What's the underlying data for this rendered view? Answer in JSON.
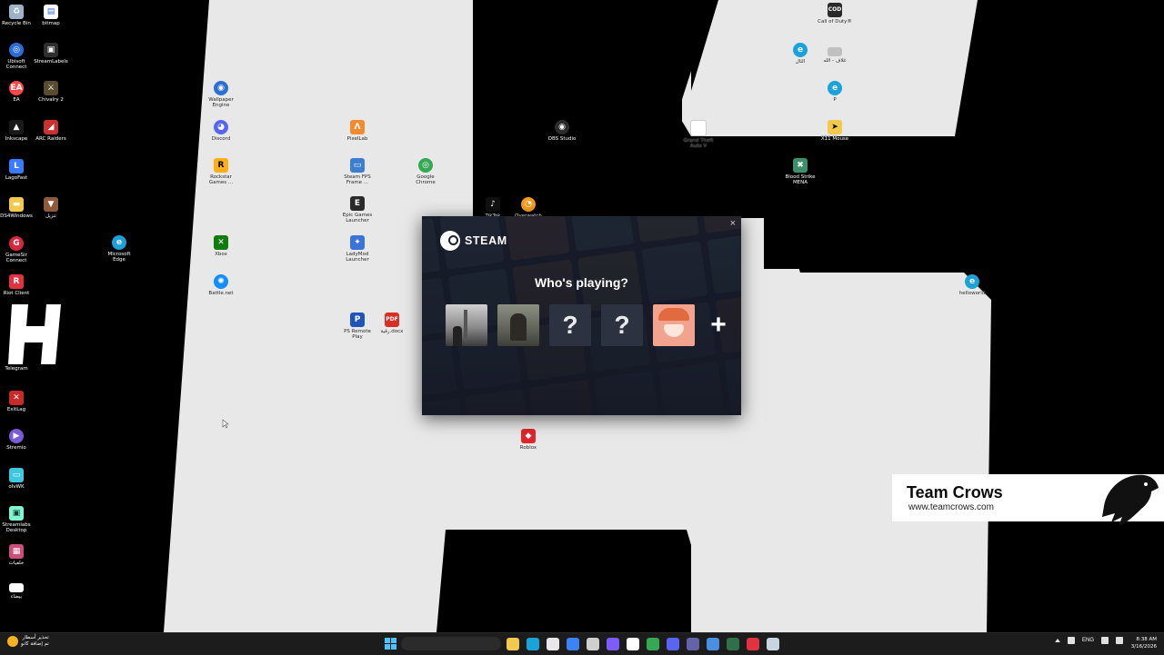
{
  "desktop_icons": [
    {
      "id": "recycle",
      "label": "Recycle Bin",
      "icon": "recycle-bin-icon",
      "color": "#9fb3c8"
    },
    {
      "id": "bitmap",
      "label": "bitmap",
      "icon": "file-icon",
      "color": "#ffffff"
    },
    {
      "id": "ubisoft",
      "label": "Ubisoft Connect",
      "icon": "ubisoft-icon",
      "color": "#2b6cd8"
    },
    {
      "id": "streamlabels",
      "label": "StreamLabels",
      "icon": "streamlabels-icon",
      "color": "#2e2e2e"
    },
    {
      "id": "ea",
      "label": "EA",
      "icon": "ea-icon",
      "color": "#ff4747"
    },
    {
      "id": "chivalry",
      "label": "Chivalry 2",
      "icon": "chivalry-icon",
      "color": "#5a4a2e"
    },
    {
      "id": "inkscape",
      "label": "Inkscape",
      "icon": "inkscape-icon",
      "color": "#1a1a1a"
    },
    {
      "id": "arc",
      "label": "ARC Raiders",
      "icon": "arc-raiders-icon",
      "color": "#c8322f"
    },
    {
      "id": "lagofast",
      "label": "LagoFast",
      "icon": "lagofast-icon",
      "color": "#3a7bff"
    },
    {
      "id": "ds4",
      "label": "DS4Windows",
      "icon": "folder-icon",
      "color": "#f2c94c"
    },
    {
      "id": "tanzil",
      "label": "تنزيل",
      "icon": "app-icon",
      "color": "#8d5a3b"
    },
    {
      "id": "gamesir",
      "label": "GameSir Connect",
      "icon": "gamesir-icon",
      "color": "#d7263d"
    },
    {
      "id": "msedge",
      "label": "Microsoft Edge",
      "icon": "edge-icon",
      "color": "#1aa3d8"
    },
    {
      "id": "riot",
      "label": "Riot Client",
      "icon": "riot-icon",
      "color": "#e0333f"
    },
    {
      "id": "telegram",
      "label": "Telegram",
      "icon": "telegram-icon",
      "color": "#2aa3e0"
    },
    {
      "id": "exitlag",
      "label": "ExitLag",
      "icon": "exitlag-icon",
      "color": "#c92a2a"
    },
    {
      "id": "stremio",
      "label": "Stremio",
      "icon": "stremio-icon",
      "color": "#7b5bd6"
    },
    {
      "id": "olvwk",
      "label": "olvWK",
      "icon": "app-icon",
      "color": "#3fc6e0"
    },
    {
      "id": "streamlabs",
      "label": "Streamlabs Desktop",
      "icon": "streamlabs-icon",
      "color": "#80f5d2"
    },
    {
      "id": "h1",
      "label": "خلفيات",
      "icon": "image-icon",
      "color": "#c94f7c"
    },
    {
      "id": "h2",
      "label": "بيضاء",
      "icon": "blank-icon",
      "color": "#ffffff"
    },
    {
      "id": "wallpaper",
      "label": "Wallpaper Engine",
      "icon": "wallpaper-engine-icon",
      "color": "#2a6fd4"
    },
    {
      "id": "discord",
      "label": "Discord",
      "icon": "discord-icon",
      "color": "#5865f2"
    },
    {
      "id": "rockstar",
      "label": "Rockstar Games ...",
      "icon": "rockstar-icon",
      "color": "#fcaf17"
    },
    {
      "id": "xbox",
      "label": "Xbox",
      "icon": "xbox-icon",
      "color": "#107c10"
    },
    {
      "id": "battlenet",
      "label": "Battle.net",
      "icon": "battlenet-icon",
      "color": "#148eff"
    },
    {
      "id": "pixelab",
      "label": "PixelLab",
      "icon": "pixellab-icon",
      "color": "#f28b30"
    },
    {
      "id": "steamfps",
      "label": "Steam FPS Frame ...",
      "icon": "app-icon",
      "color": "#3e7ecf"
    },
    {
      "id": "epic",
      "label": "Epic Games Launcher",
      "icon": "epic-icon",
      "color": "#2a2a2a"
    },
    {
      "id": "ladymod",
      "label": "LadyMod Launcher",
      "icon": "ladymod-icon",
      "color": "#3a74d8"
    },
    {
      "id": "ps",
      "label": "PS Remote Play",
      "icon": "ps-remote-icon",
      "color": "#1f55b8"
    },
    {
      "id": "pdf",
      "label": "رقية.docx",
      "icon": "pdf-icon",
      "color": "#d93025"
    },
    {
      "id": "chrome",
      "label": "Google Chrome",
      "icon": "chrome-icon",
      "color": "#34a853"
    },
    {
      "id": "tiktok",
      "label": "TikTok",
      "icon": "tiktok-icon",
      "color": "#111111"
    },
    {
      "id": "overwatch",
      "label": "Overwatch",
      "icon": "overwatch-icon",
      "color": "#f79d1f"
    },
    {
      "id": "obs",
      "label": "OBS Studio",
      "icon": "obs-icon",
      "color": "#2b2b2b"
    },
    {
      "id": "roblox",
      "label": "Roblox",
      "icon": "roblox-icon",
      "color": "#e0262d"
    },
    {
      "id": "gta",
      "label": "Grand Theft Auto V",
      "icon": "file-icon",
      "color": "#ffffff"
    },
    {
      "id": "cod",
      "label": "Call of Duty®",
      "icon": "cod-icon",
      "color": "#2a2a2a"
    },
    {
      "id": "edgeapp",
      "label": "الثال",
      "icon": "edge-icon",
      "color": "#1aa3d8"
    },
    {
      "id": "lang",
      "label": "غلاف - الله",
      "icon": "app-icon",
      "color": "#c0c0c0"
    },
    {
      "id": "edge2",
      "label": "P",
      "icon": "edge-icon",
      "color": "#1aa3d8"
    },
    {
      "id": "x11",
      "label": "X11 Mouse",
      "icon": "x11-mouse-icon",
      "color": "#f2c94c"
    },
    {
      "id": "bloodstrike",
      "label": "Blood Strike MENA",
      "icon": "bloodstrike-icon",
      "color": "#3a8f6d"
    },
    {
      "id": "helloworld",
      "label": "helloworld",
      "icon": "edge-icon",
      "color": "#1aa3d8"
    }
  ],
  "steam_dialog": {
    "logo_text": "STEAM",
    "title": "Who's playing?",
    "profiles": [
      {
        "label": "?",
        "kind": "unknown"
      },
      {
        "label": "?",
        "kind": "unknown"
      }
    ],
    "add_label": "+",
    "close_label": "×"
  },
  "banner": {
    "title": "Team Crows",
    "url": "www.teamcrows.com"
  },
  "taskbar": {
    "notification_line1": "تحذير أسطار",
    "notification_line2": "تم إضافة كانو",
    "search_placeholder": "",
    "tray_lang": "ENG",
    "clock_time": "8:38 AM",
    "clock_date": "3/16/2026",
    "pinned": [
      {
        "icon": "file-explorer-icon",
        "color": "#f2c94c"
      },
      {
        "icon": "edge-icon",
        "color": "#1aa3d8"
      },
      {
        "icon": "store-icon",
        "color": "#e8e8e8"
      },
      {
        "icon": "mail-icon",
        "color": "#3b82f6"
      },
      {
        "icon": "app-icon",
        "color": "#cfcfcf"
      },
      {
        "icon": "controller-icon",
        "color": "#7c5cff"
      },
      {
        "icon": "tiktok-icon",
        "color": "#ffffff"
      },
      {
        "icon": "chrome-icon",
        "color": "#34a853"
      },
      {
        "icon": "discord-icon",
        "color": "#5865f2"
      },
      {
        "icon": "teams-icon",
        "color": "#6264a7"
      },
      {
        "icon": "app-icon",
        "color": "#4a90e2"
      },
      {
        "icon": "terminal-icon",
        "color": "#2f6f4a"
      },
      {
        "icon": "app-icon",
        "color": "#e0333f"
      },
      {
        "icon": "steam-icon",
        "color": "#c7d5e0"
      }
    ]
  }
}
